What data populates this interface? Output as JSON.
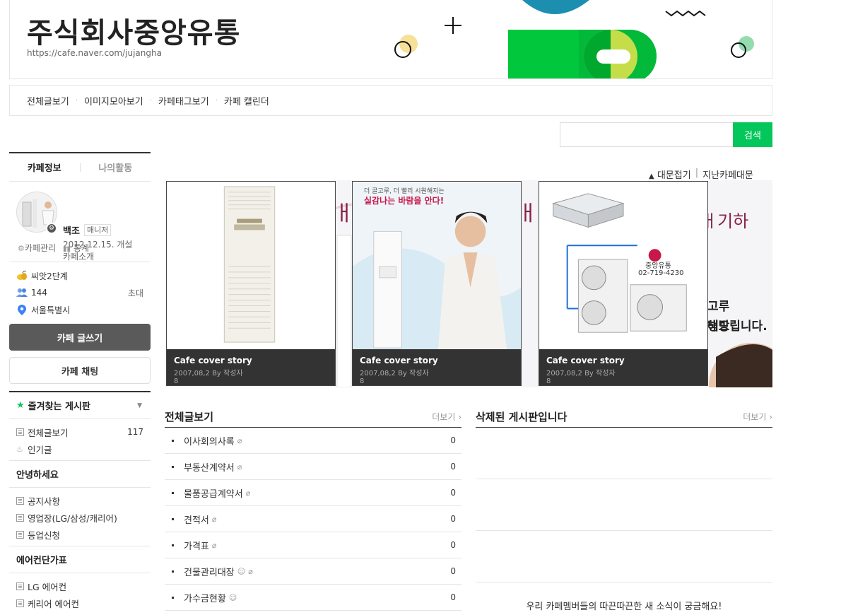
{
  "header": {
    "cafe_name": "주식회사중앙유통",
    "cafe_url": "https://cafe.naver.com/jujangha"
  },
  "menubar": {
    "items": [
      "전체글보기",
      "이미지모아보기",
      "카페태그보기",
      "카페 캘린더"
    ]
  },
  "search": {
    "placeholder": "",
    "button_label": "검색"
  },
  "sidebar": {
    "tabs": [
      "카페정보",
      "나의활동"
    ],
    "profile": {
      "name": "백조",
      "role": "매니저",
      "founded": "2012.12.15. 개설",
      "intro": "카페소개"
    },
    "links": [
      "카페관리",
      "통계"
    ],
    "stats": {
      "level": "씨앗2단계",
      "members": "144",
      "invite": "초대",
      "location": "서울특별시"
    },
    "write_button": "카페 글쓰기",
    "chat_button": "카페 채팅",
    "favorites_title": "즐겨찾는 게시판",
    "favorites": [
      {
        "label": "전체글보기",
        "count": "117"
      },
      {
        "label": "인기글",
        "count": ""
      }
    ],
    "groups": [
      {
        "title": "안녕하세요",
        "items": [
          "공지사항",
          "영업장(LG/삼성/캐리어)",
          "등업신청"
        ]
      },
      {
        "title": "에어컨단가표",
        "items": [
          "LG 에어컨",
          "케리어 에어컨"
        ]
      }
    ]
  },
  "cover": {
    "toggle_fold": "대문접기",
    "toggle_past": "지난카페대문",
    "cards": [
      {
        "title": "Cafe cover story",
        "meta": "2007,08,2  By  작성자",
        "num": "8"
      },
      {
        "title": "Cafe cover story",
        "meta": "2007,08,2  By  작성자",
        "num": "8"
      },
      {
        "title": "Cafe cover story",
        "meta": "2007,08,2  By  작성자",
        "num": "8"
      }
    ],
    "ad_headline": "실감나는 바람을 안다!",
    "ad_sub": "더 골고루, 더 빨리 시원해지는",
    "lg_text": "중앙유통",
    "lg_phone": "02-719-4230",
    "bg_text_1": "고루",
    "bg_text_2": "냉방",
    "bg_text_3": "해드립니다."
  },
  "boards": {
    "all": {
      "title": "전체글보기",
      "more": "더보기",
      "rows": [
        {
          "title": "이사회의사록",
          "count": "0",
          "clip": true,
          "face": false
        },
        {
          "title": "부동산계약서",
          "count": "0",
          "clip": true,
          "face": false
        },
        {
          "title": "물품공급계약서",
          "count": "0",
          "clip": true,
          "face": false
        },
        {
          "title": "견적서",
          "count": "0",
          "clip": true,
          "face": false
        },
        {
          "title": "가격표",
          "count": "0",
          "clip": true,
          "face": false
        },
        {
          "title": "건물관리대장",
          "count": "0",
          "clip": true,
          "face": true
        },
        {
          "title": "가수금현황",
          "count": "0",
          "clip": false,
          "face": true
        }
      ]
    },
    "deleted": {
      "title": "삭제된 게시판입니다",
      "more": "더보기",
      "empty_message": "우리 카페멤버들의 따끈따끈한 새 소식이 궁금해요!"
    }
  },
  "colors": {
    "accent_green": "#03c75a",
    "dark_button": "#5a5a5a"
  }
}
